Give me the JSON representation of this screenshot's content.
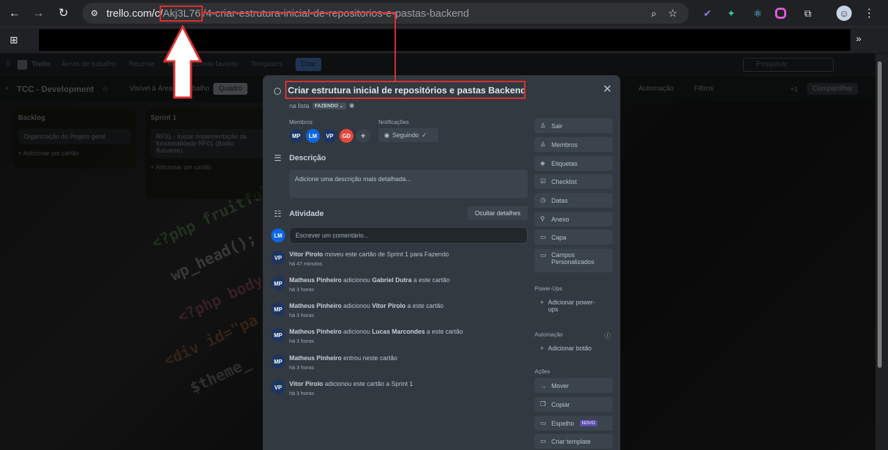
{
  "browser": {
    "url_host": "trello.com/c/",
    "url_id": "Akj3L76l",
    "url_rest": "/4-criar-estrutura-inicial-de-repositorios-e-pastas-backend"
  },
  "trello_nav": {
    "logo": "Trello",
    "workspaces": "Áreas de trabalho",
    "recent": "Recente",
    "starred": "Marcado como favorito",
    "templates": "Templates",
    "create": "Criar",
    "search_placeholder": "Pesquisar"
  },
  "board": {
    "title": "TCC - Development",
    "visibility": "Visível à Área de trabalho",
    "view": "Quadro",
    "automation": "Automação",
    "filters": "Filtros",
    "share": "Compartilhar",
    "more_members": "+1"
  },
  "lists": [
    {
      "title": "Backlog",
      "card": "Organização do Projeto geral",
      "add": "Adicionar um cartão"
    },
    {
      "title": "Sprint 1",
      "card": "RF01 - Iniciar implementação da funcionalidade RF01 (Botão flutuante).",
      "add": "Adicionar um cartão"
    }
  ],
  "card": {
    "title": "Criar estrutura inicial de repositórios e pastas Backend",
    "in_list_prefix": "na lista",
    "list_name": "FAZENDO",
    "members_label": "Membros",
    "notifications_label": "Notificações",
    "follow_label": "Seguindo",
    "members": [
      {
        "initials": "MP",
        "color": "#1d3561"
      },
      {
        "initials": "LM",
        "color": "#0c66e4"
      },
      {
        "initials": "VP",
        "color": "#1d3561"
      },
      {
        "initials": "GD",
        "color": "#e2483d"
      }
    ],
    "description_heading": "Descrição",
    "description_placeholder": "Adicione uma descrição mais detalhada...",
    "activity_heading": "Atividade",
    "hide_details": "Ocultar detalhes",
    "comment_avatar": "LM",
    "comment_placeholder": "Escrever um comentário...",
    "activities": [
      {
        "initials": "VP",
        "user": "Vitor Pirolo",
        "text": " moveu este cartão de Sprint 1 para Fazendo",
        "time": "há 47 minutos"
      },
      {
        "initials": "MP",
        "user": "Matheus Pinheiro",
        "text": " adicionou ",
        "target": "Gabriel Dutra",
        "text2": " a este cartão",
        "time": "há 3 horas"
      },
      {
        "initials": "MP",
        "user": "Matheus Pinheiro",
        "text": " adicionou ",
        "target": "Vitor Pirolo",
        "text2": " a este cartão",
        "time": "há 3 horas"
      },
      {
        "initials": "MP",
        "user": "Matheus Pinheiro",
        "text": " adicionou ",
        "target": "Lucas Marcondes",
        "text2": " a este cartão",
        "time": "há 3 horas"
      },
      {
        "initials": "MP",
        "user": "Matheus Pinheiro",
        "text": " entrou neste cartão",
        "time": "há 3 horas"
      },
      {
        "initials": "VP",
        "user": "Vitor Pirolo",
        "text": " adicionou este cartão a Sprint 1",
        "time": "há 3 horas"
      }
    ],
    "sidebar": {
      "leave": "Sair",
      "members": "Membros",
      "labels": "Etiquetas",
      "checklist": "Checklist",
      "dates": "Datas",
      "attachment": "Anexo",
      "cover": "Capa",
      "custom_fields_1": "Campos",
      "custom_fields_2": "Personalizados",
      "powerups_label": "Power-Ups",
      "add_powerups_1": "Adicionar power-",
      "add_powerups_2": "ups",
      "automation_label": "Automação",
      "add_button": "Adicionar botão",
      "actions_label": "Ações",
      "move": "Mover",
      "copy": "Copiar",
      "mirror": "Espelho",
      "new_badge": "NOVO",
      "create_template": "Criar template"
    }
  }
}
